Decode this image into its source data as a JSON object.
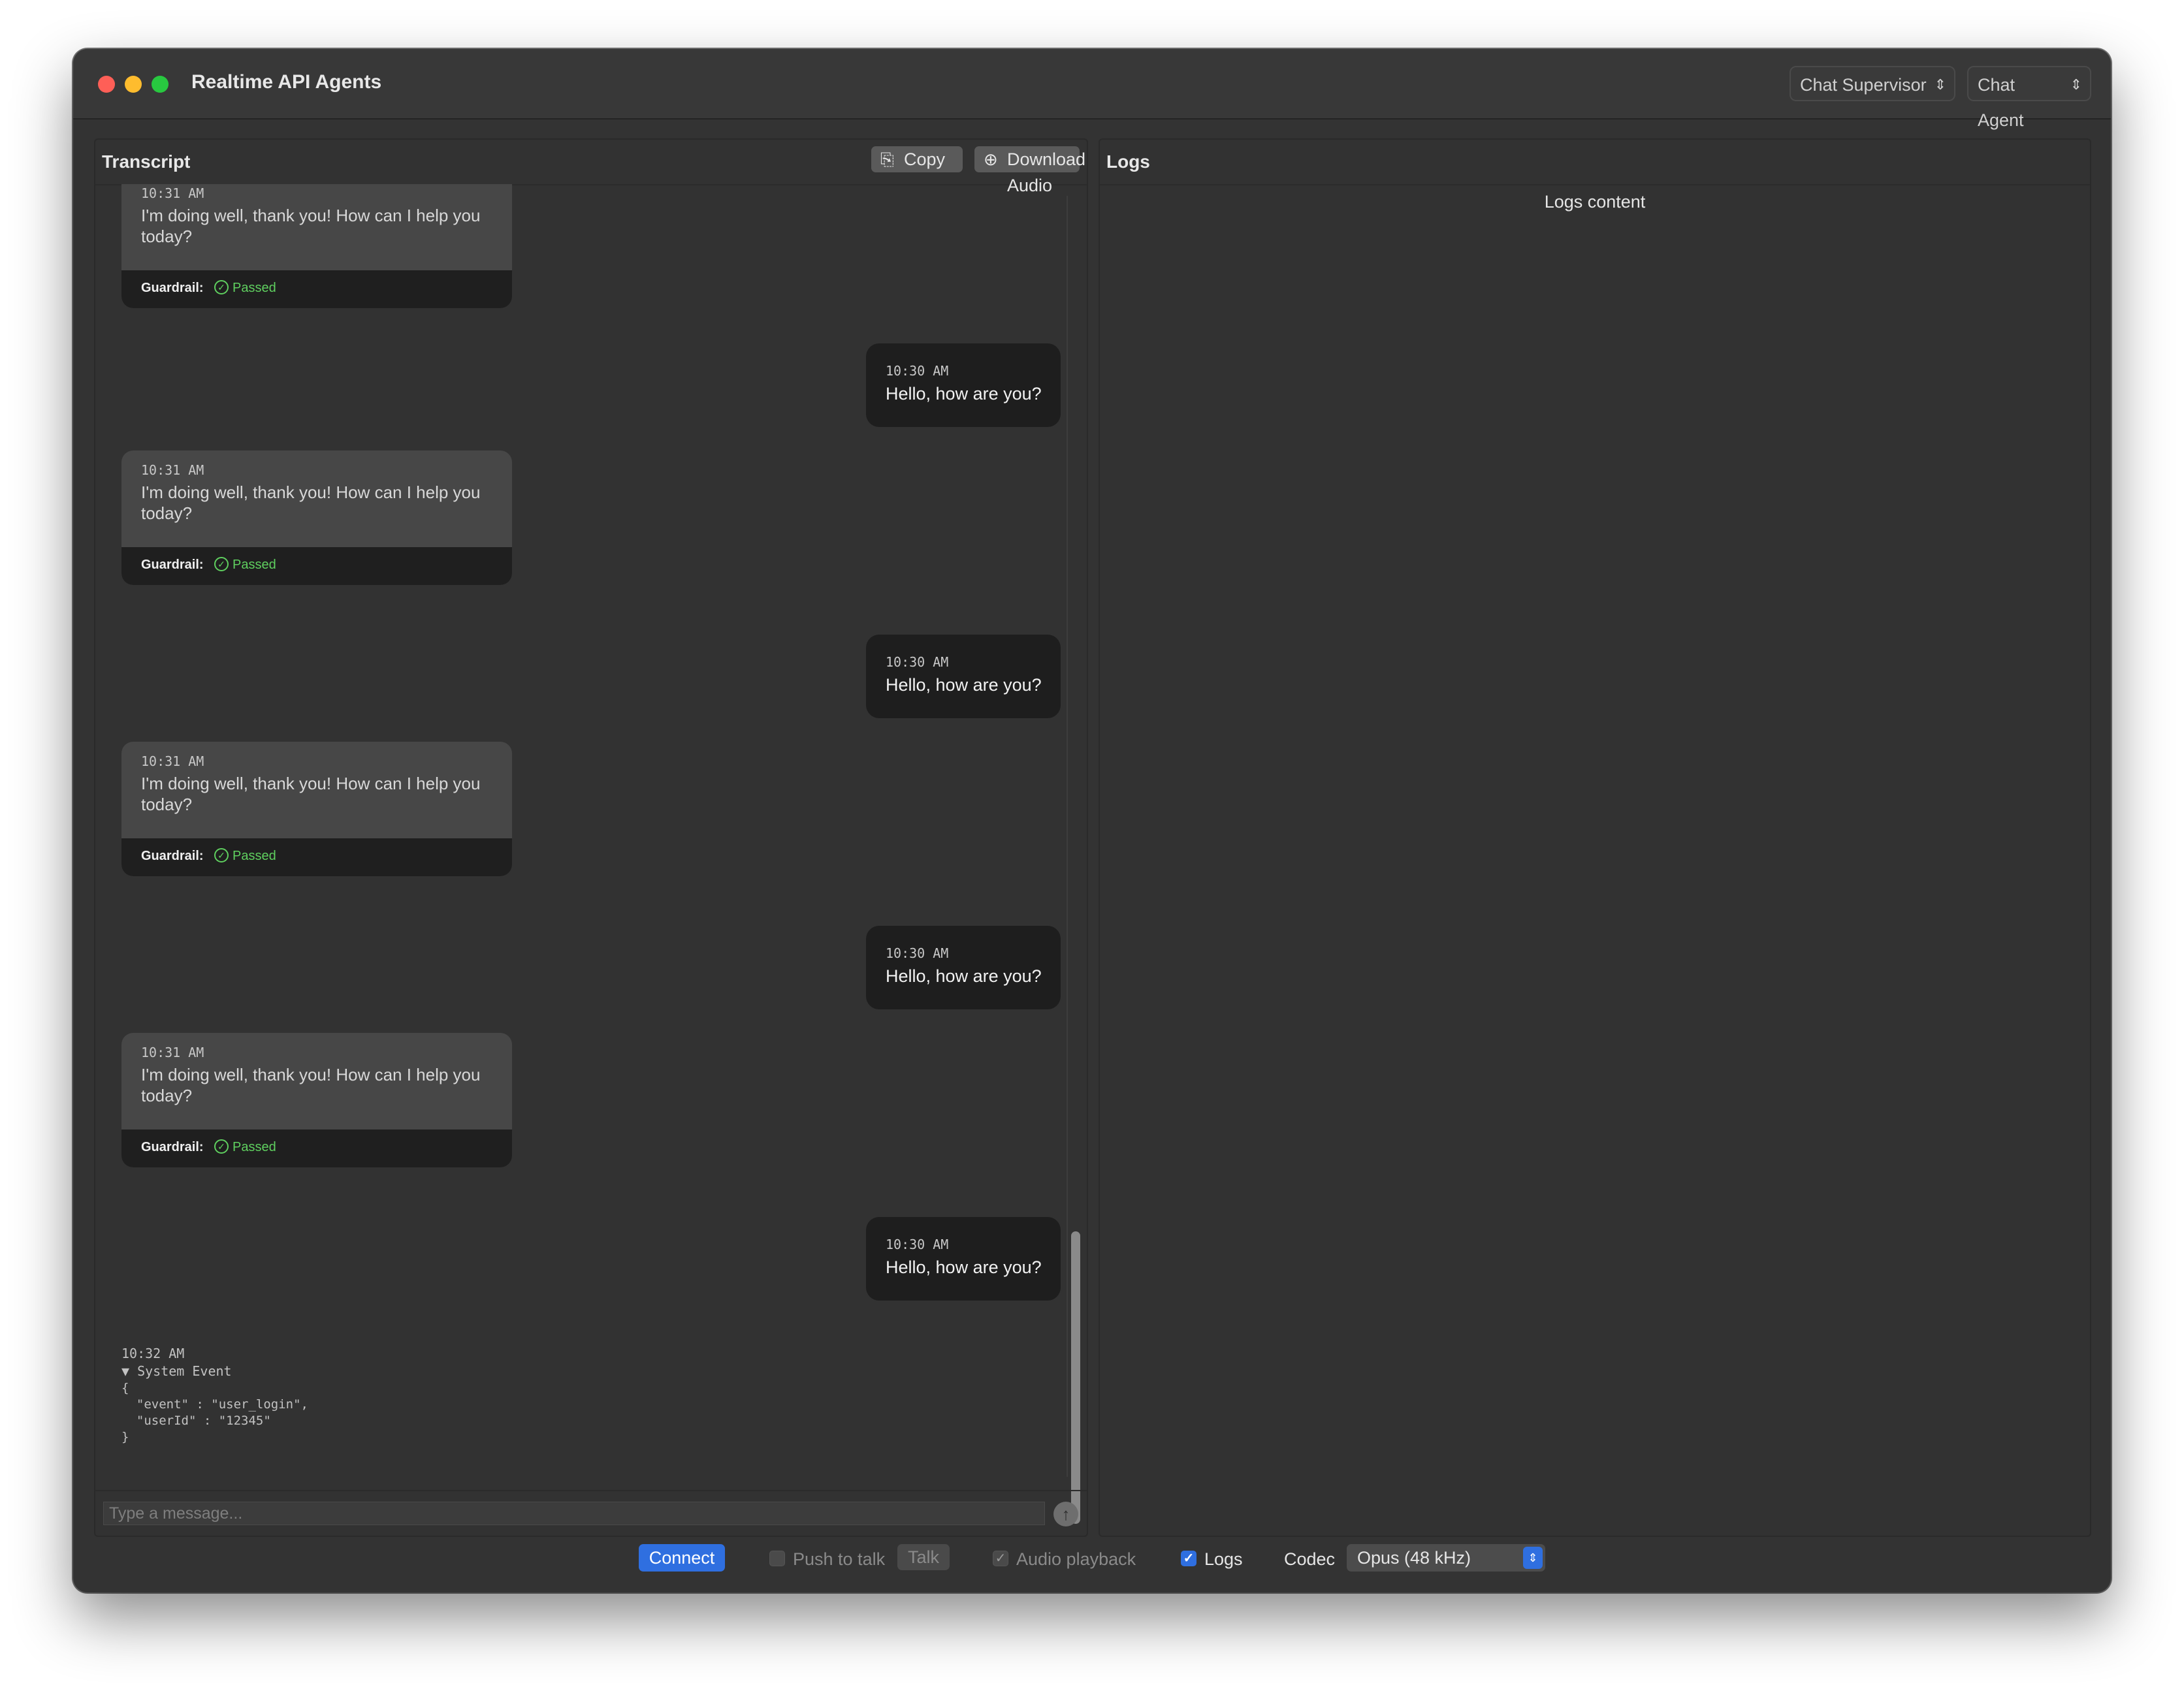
{
  "window": {
    "title": "Realtime API Agents"
  },
  "header": {
    "scenario_select": "Chat Supervisor",
    "agent_select": "Chat Agent"
  },
  "transcript": {
    "title": "Transcript",
    "copy_label": "Copy",
    "download_label": "Download Audio",
    "assistant_messages": [
      {
        "time": "10:31 AM",
        "text": "I'm doing well, thank you! How can I help you today?",
        "guardrail_label": "Guardrail:",
        "guardrail_status": "Passed"
      },
      {
        "time": "10:31 AM",
        "text": "I'm doing well, thank you! How can I help you today?",
        "guardrail_label": "Guardrail:",
        "guardrail_status": "Passed"
      },
      {
        "time": "10:31 AM",
        "text": "I'm doing well, thank you! How can I help you today?",
        "guardrail_label": "Guardrail:",
        "guardrail_status": "Passed"
      },
      {
        "time": "10:31 AM",
        "text": "I'm doing well, thank you! How can I help you today?",
        "guardrail_label": "Guardrail:",
        "guardrail_status": "Passed"
      }
    ],
    "user_messages": [
      {
        "time": "10:30 AM",
        "text": "Hello, how are you?"
      },
      {
        "time": "10:30 AM",
        "text": "Hello, how are you?"
      },
      {
        "time": "10:30 AM",
        "text": "Hello, how are you?"
      },
      {
        "time": "10:30 AM",
        "text": "Hello, how are you?"
      }
    ],
    "system_event": {
      "time": "10:32 AM",
      "title": "▼ System Event",
      "body": "{\n  \"event\" : \"user_login\",\n  \"userId\" : \"12345\"\n}"
    },
    "input_placeholder": "Type a message..."
  },
  "logs": {
    "title": "Logs",
    "content": "Logs content"
  },
  "bottom_bar": {
    "connect_label": "Connect",
    "push_to_talk_label": "Push to talk",
    "push_to_talk_checked": false,
    "talk_label": "Talk",
    "audio_playback_label": "Audio playback",
    "audio_playback_checked": true,
    "logs_label": "Logs",
    "logs_checked": true,
    "codec_label": "Codec",
    "codec_value": "Opus (48 kHz)"
  },
  "icons": {
    "copy": "clipboard-icon",
    "download": "download-circle-icon",
    "send": "arrow-up-icon",
    "check": "check-circle-icon",
    "stepper": "chevron-updown-icon"
  },
  "colors": {
    "accent": "#2f6fe0",
    "passed": "#5fd05f",
    "window_bg": "#333333"
  }
}
